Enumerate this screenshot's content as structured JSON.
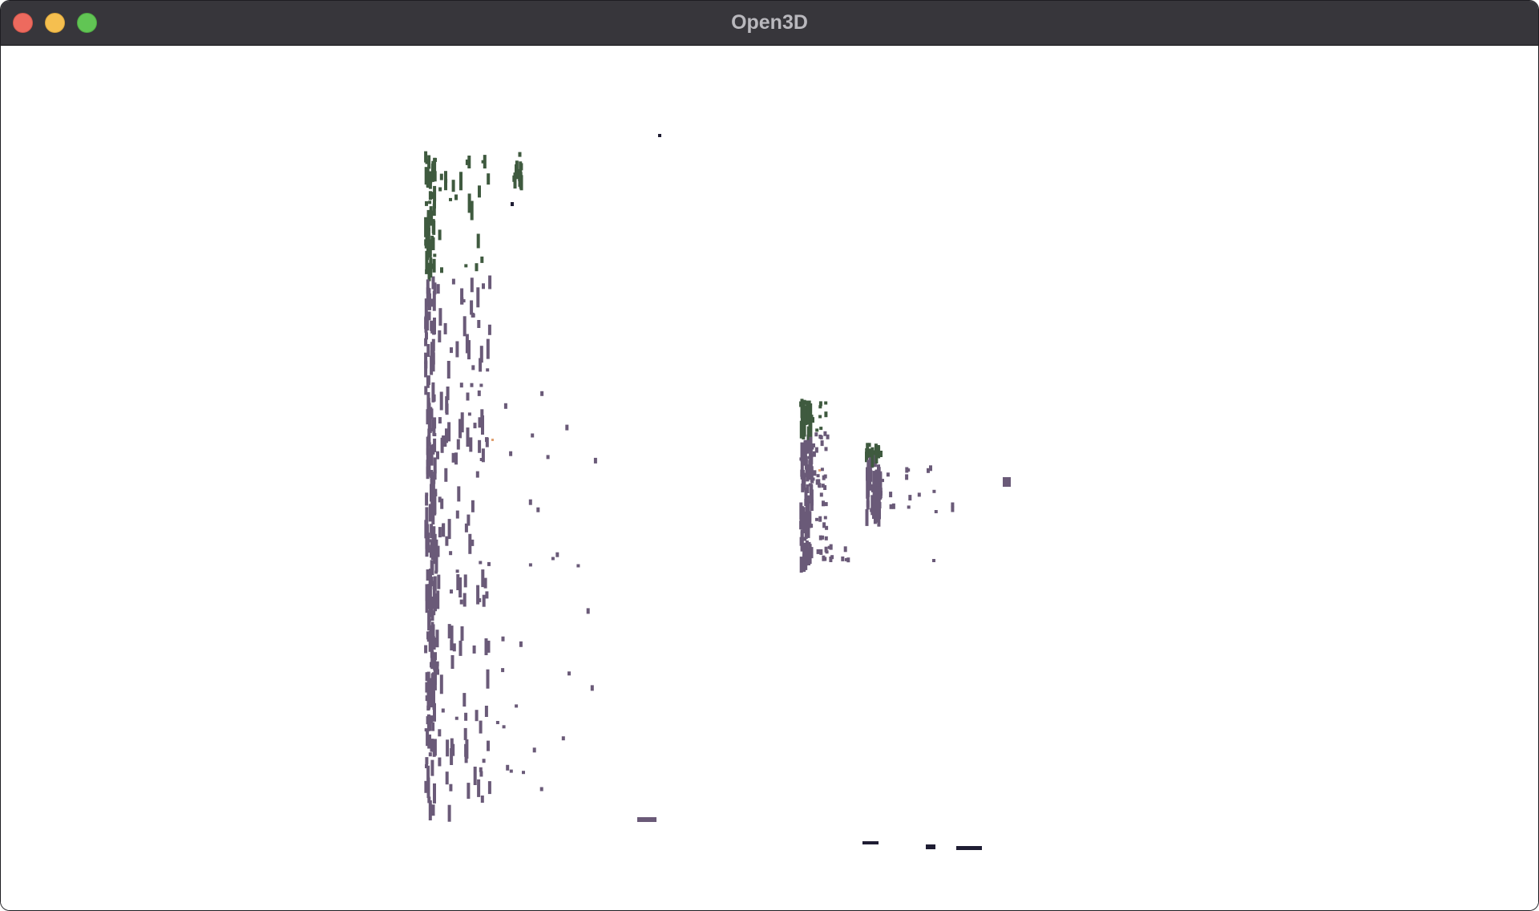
{
  "window": {
    "title": "Open3D",
    "controls": {
      "close": "close-button",
      "minimize": "minimize-button",
      "maximize": "maximize-button"
    }
  },
  "viewport": {
    "content": "point-cloud",
    "background_color": "#ffffff",
    "point_colors": {
      "green": "#3f5a3f",
      "purple": "#6a5a78",
      "dark": "#1f1d33",
      "accent": "#e0a070"
    }
  }
}
